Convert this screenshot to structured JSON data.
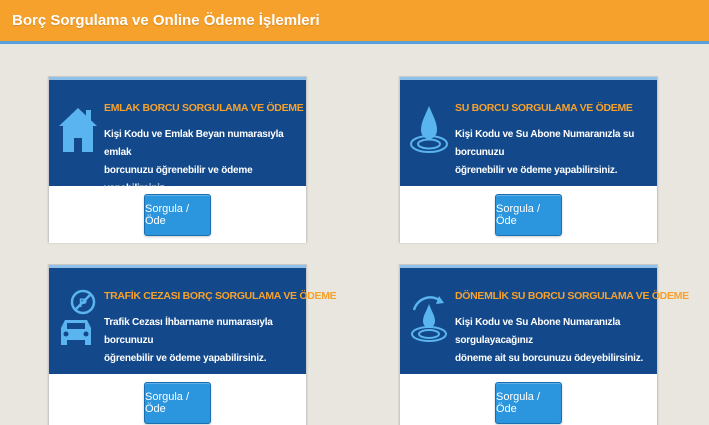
{
  "header": {
    "title": "Borç Sorgulama ve Online Ödeme İşlemleri"
  },
  "colors": {
    "header_bg": "#f6a12c",
    "card_bg": "#13498b",
    "title_color": "#f6a12c",
    "button_bg": "#2b95de",
    "icon_color": "#5ab4ef"
  },
  "cards": [
    {
      "icon": "house-icon",
      "title": "EMLAK BORCU SORGULAMA VE ÖDEME",
      "desc_line1": "Kişi Kodu ve Emlak Beyan numarasıyla emlak",
      "desc_line2": "borcunuzu öğrenebilir ve ödeme yapabilirsiniz.",
      "button_label": "Sorgula / Öde"
    },
    {
      "icon": "water-drop-icon",
      "title": "SU BORCU SORGULAMA VE ÖDEME",
      "desc_line1": "Kişi Kodu ve Su Abone Numaranızla su borcunuzu",
      "desc_line2": "öğrenebilir ve ödeme yapabilirsiniz.",
      "button_label": "Sorgula / Öde"
    },
    {
      "icon": "traffic-car-icon",
      "title": "TRAFİK CEZASI BORÇ SORGULAMA VE ÖDEME",
      "desc_line1": "Trafik Cezası İhbarname numarasıyla borcunuzu",
      "desc_line2": "öğrenebilir ve ödeme yapabilirsiniz.",
      "button_label": "Sorgula / Öde"
    },
    {
      "icon": "periodic-water-icon",
      "title": "DÖNEMLİK SU BORCU SORGULAMA VE ÖDEME",
      "desc_line1": "Kişi Kodu ve Su Abone Numaranızla sorgulayacağınız",
      "desc_line2": "döneme ait su borcunuzu ödeyebilirsiniz.",
      "button_label": "Sorgula / Öde"
    }
  ]
}
